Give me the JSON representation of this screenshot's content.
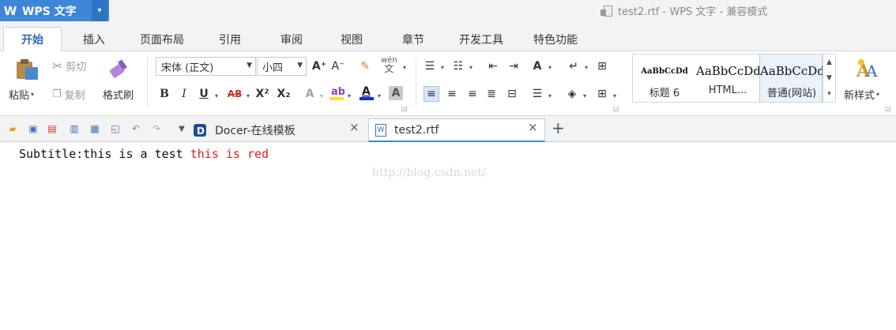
{
  "app": {
    "logo": "W",
    "name": "WPS 文字",
    "menu_arrow": "▾",
    "doc_title": "test2.rtf - WPS 文字 - 兼容模式"
  },
  "ribbon_tabs": [
    "开始",
    "插入",
    "页面布局",
    "引用",
    "审阅",
    "视图",
    "章节",
    "开发工具",
    "特色功能"
  ],
  "clipboard": {
    "paste": "粘贴",
    "cut": "剪切",
    "copy": "复制",
    "format_painter": "格式刷"
  },
  "font": {
    "family": "宋体 (正文)",
    "size": "小四",
    "bold": "B",
    "italic": "I",
    "underline": "U",
    "strike": "AB",
    "superscript": "X²",
    "subscript": "X₂",
    "grow": "A⁺",
    "shrink": "A⁻",
    "pinyin_top": "wén",
    "pinyin_bottom": "文",
    "color_a": "A"
  },
  "styles": [
    {
      "sample": "AaBbCcDd",
      "name": "标题 6"
    },
    {
      "sample": "AaBbCcDd",
      "name": "HTML..."
    },
    {
      "sample": "AaBbCcDd",
      "name": "普通(网站)"
    }
  ],
  "new_style": "新样式",
  "doc_tabs": {
    "docer": "Docer-在线模板",
    "file": "test2.rtf",
    "close": "×",
    "add": "+"
  },
  "document": {
    "text_black": "Subtitle:this is a test ",
    "text_red": "this is red"
  },
  "watermark": "http://blog.csdn.net/",
  "colors": {
    "accent": "#3d86d8",
    "red_text": "#e0201b",
    "highlight": "#f5e32e",
    "font_color_bar": "#1030d0"
  }
}
